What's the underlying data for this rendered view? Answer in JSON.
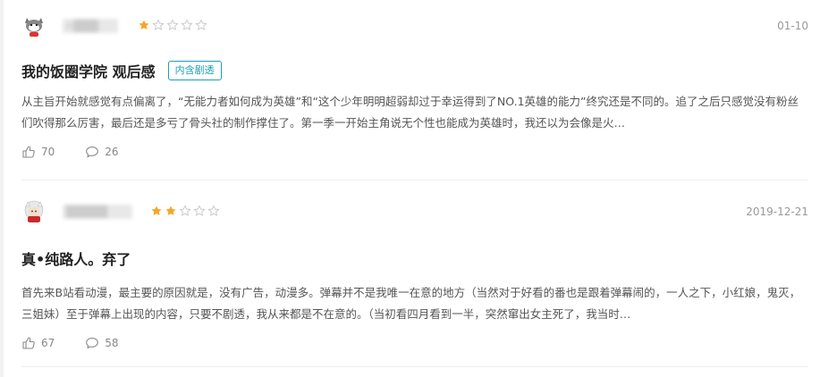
{
  "reviews": [
    {
      "username": "A███",
      "rating": 1,
      "rating_max": 5,
      "date": "01-10",
      "title": "我的饭圈学院 观后感",
      "tag": "内含剧透",
      "body": "从主旨开始就感觉有点偏离了，“无能力者如何成为英雄”和“这个少年明明超弱却过于幸运得到了NO.1英雄的能力”终究还是不同的。追了之后只感觉没有粉丝们吹得那么厉害，最后还是多亏了骨头社的制作撑住了。第一季一开始主角说无个性也能成为英雄时，我还以为会像是火…",
      "likes": "70",
      "comments": "26"
    },
    {
      "username": "█████",
      "rating": 2,
      "rating_max": 5,
      "date": "2019-12-21",
      "title": "真•纯路人。弃了",
      "tag": "",
      "body": "首先来B站看动漫，最主要的原因就是，没有广告，动漫多。弹幕并不是我唯一在意的地方（当然对于好看的番也是跟着弹幕闹的，一人之下，小红娘，鬼灭，三姐妹）至于弹幕上出现的内容，只要不剧透，我从来都是不在意的。（当初看四月看到一半，突然窜出女主死了，我当时…",
      "likes": "67",
      "comments": "58"
    }
  ],
  "colors": {
    "star_filled": "#f5a623",
    "star_empty": "#c8c8c8",
    "tag": "#1aa1b5"
  },
  "icons": {
    "like": "thumbs-up-icon",
    "comment": "comment-bubble-icon"
  }
}
